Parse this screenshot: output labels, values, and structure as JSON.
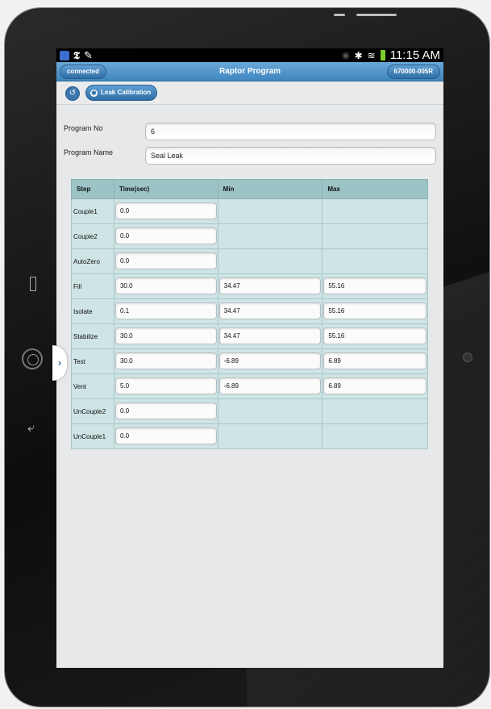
{
  "status_bar": {
    "time": "11:15 AM",
    "icons": [
      "app-icon",
      "nyt-icon",
      "pen-icon",
      "eye-icon",
      "bluetooth-icon",
      "wifi-icon",
      "battery-icon"
    ]
  },
  "app_bar": {
    "connection_label": "connected",
    "title": "Raptor Program",
    "device_id": "670000-005R"
  },
  "toolbar": {
    "back_icon": "refresh-icon",
    "calibration_label": "Leak Calibration"
  },
  "form": {
    "program_no": {
      "label": "Program No",
      "value": "6"
    },
    "program_name": {
      "label": "Program Name",
      "value": "Seal Leak"
    }
  },
  "table": {
    "headers": [
      "Step",
      "Time(sec)",
      "Min",
      "Max"
    ],
    "rows": [
      {
        "step": "Couple1",
        "time": "0.0",
        "min": "",
        "max": ""
      },
      {
        "step": "Couple2",
        "time": "0.0",
        "min": "",
        "max": ""
      },
      {
        "step": "AutoZero",
        "time": "0.0",
        "min": "",
        "max": ""
      },
      {
        "step": "Fill",
        "time": "30.0",
        "min": "34.47",
        "max": "55.16"
      },
      {
        "step": "Isolate",
        "time": "0.1",
        "min": "34.47",
        "max": "55.16"
      },
      {
        "step": "Stabilize",
        "time": "30.0",
        "min": "34.47",
        "max": "55.16"
      },
      {
        "step": "Test",
        "time": "30.0",
        "min": "-6.89",
        "max": "6.89"
      },
      {
        "step": "Vent",
        "time": "5.0",
        "min": "-6.89",
        "max": "6.89"
      },
      {
        "step": "UnCouple2",
        "time": "0.0",
        "min": "",
        "max": ""
      },
      {
        "step": "UnCouple1",
        "time": "0.0",
        "min": "",
        "max": ""
      }
    ]
  },
  "colors": {
    "accent": "#3f86c0",
    "table_header": "#9cc3c6",
    "table_cell": "#cfe4e5"
  }
}
